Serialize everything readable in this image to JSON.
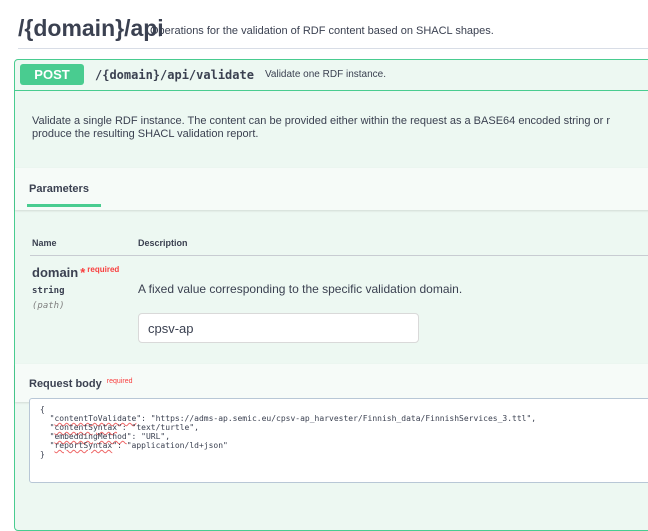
{
  "tag": {
    "title": "/{domain}/api",
    "description": "Operations for the validation of RDF content based on SHACL shapes."
  },
  "operation": {
    "method": "POST",
    "path": "/{domain}/api/validate",
    "summary": "Validate one RDF instance.",
    "description_line1": "Validate a single RDF instance. The content can be provided either within the request as a BASE64 encoded string or r",
    "description_line2": "produce the resulting SHACL validation report.",
    "method_color": "#49cc90"
  },
  "parameters": {
    "tab_label": "Parameters",
    "col_name": "Name",
    "col_description": "Description",
    "items": [
      {
        "name": "domain",
        "required_star": "*",
        "required_text": "required",
        "type": "string",
        "in": "(path)",
        "description": "A fixed value corresponding to the specific validation domain.",
        "value": "cpsv-ap"
      }
    ]
  },
  "request_body": {
    "title": "Request body",
    "required_text": "required",
    "open": "{",
    "close": "}",
    "fields": [
      {
        "key": "contentToValidate",
        "value": "\"https://adms-ap.semic.eu/cpsv-ap_harvester/Finnish_data/FinnishServices_3.ttl\","
      },
      {
        "key": "contentSyntax",
        "value": "\"text/turtle\","
      },
      {
        "key": "embeddingMethod",
        "value": "\"URL\","
      },
      {
        "key": "reportSyntax",
        "value": "\"application/ld+json\""
      }
    ]
  }
}
